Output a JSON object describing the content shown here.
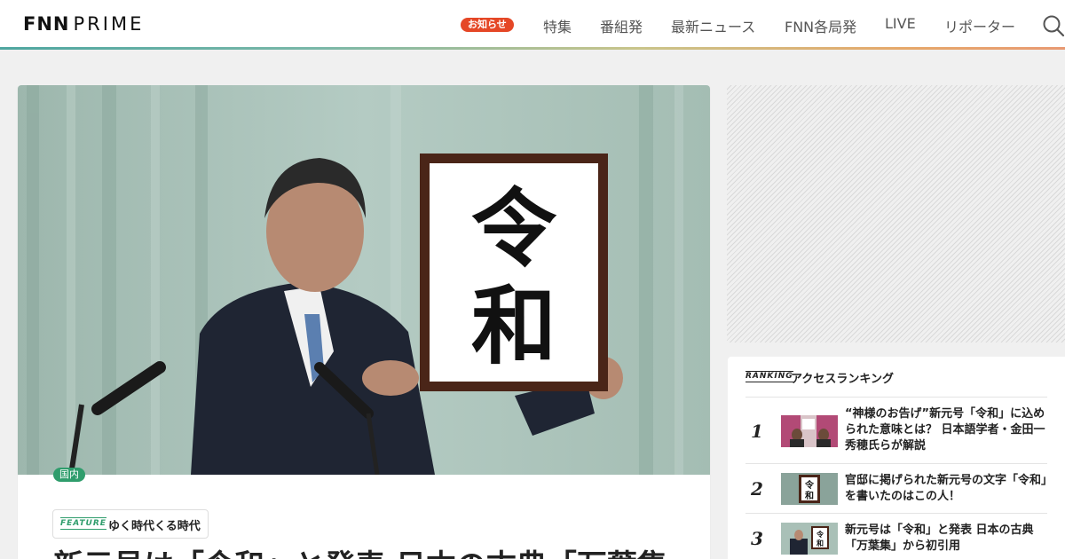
{
  "header": {
    "logo_main": "FNN",
    "logo_sub": "PRIME",
    "notice_label": "お知らせ",
    "nav": [
      {
        "label": "特集"
      },
      {
        "label": "番組発"
      },
      {
        "label": "最新ニュース"
      },
      {
        "label": "FNN各局発"
      },
      {
        "label": "LIVE"
      },
      {
        "label": "リポーター"
      }
    ],
    "search_icon": "search-icon"
  },
  "article": {
    "category": "国内",
    "feature_word": "FEATURE",
    "feature_name": "ゆく時代くる時代",
    "headline": "新元号は「令和」と発表 日本の古典「万葉集",
    "sign_text": [
      "令",
      "和"
    ]
  },
  "ranking": {
    "header_word": "RANKING",
    "title": "アクセスランキング",
    "items": [
      {
        "rank": "1",
        "title": "“神様のお告げ”新元号「令和」に込められた意味とは？ 日本語学者・金田一秀穂氏らが解説"
      },
      {
        "rank": "2",
        "title": "官邸に掲げられた新元号の文字「令和」を書いたのはこの人！"
      },
      {
        "rank": "3",
        "title": "新元号は「令和」と発表 日本の古典「万葉集」から初引用"
      }
    ]
  },
  "colors": {
    "accent_green": "#2f9d6c",
    "notice_red": "#e54726"
  }
}
